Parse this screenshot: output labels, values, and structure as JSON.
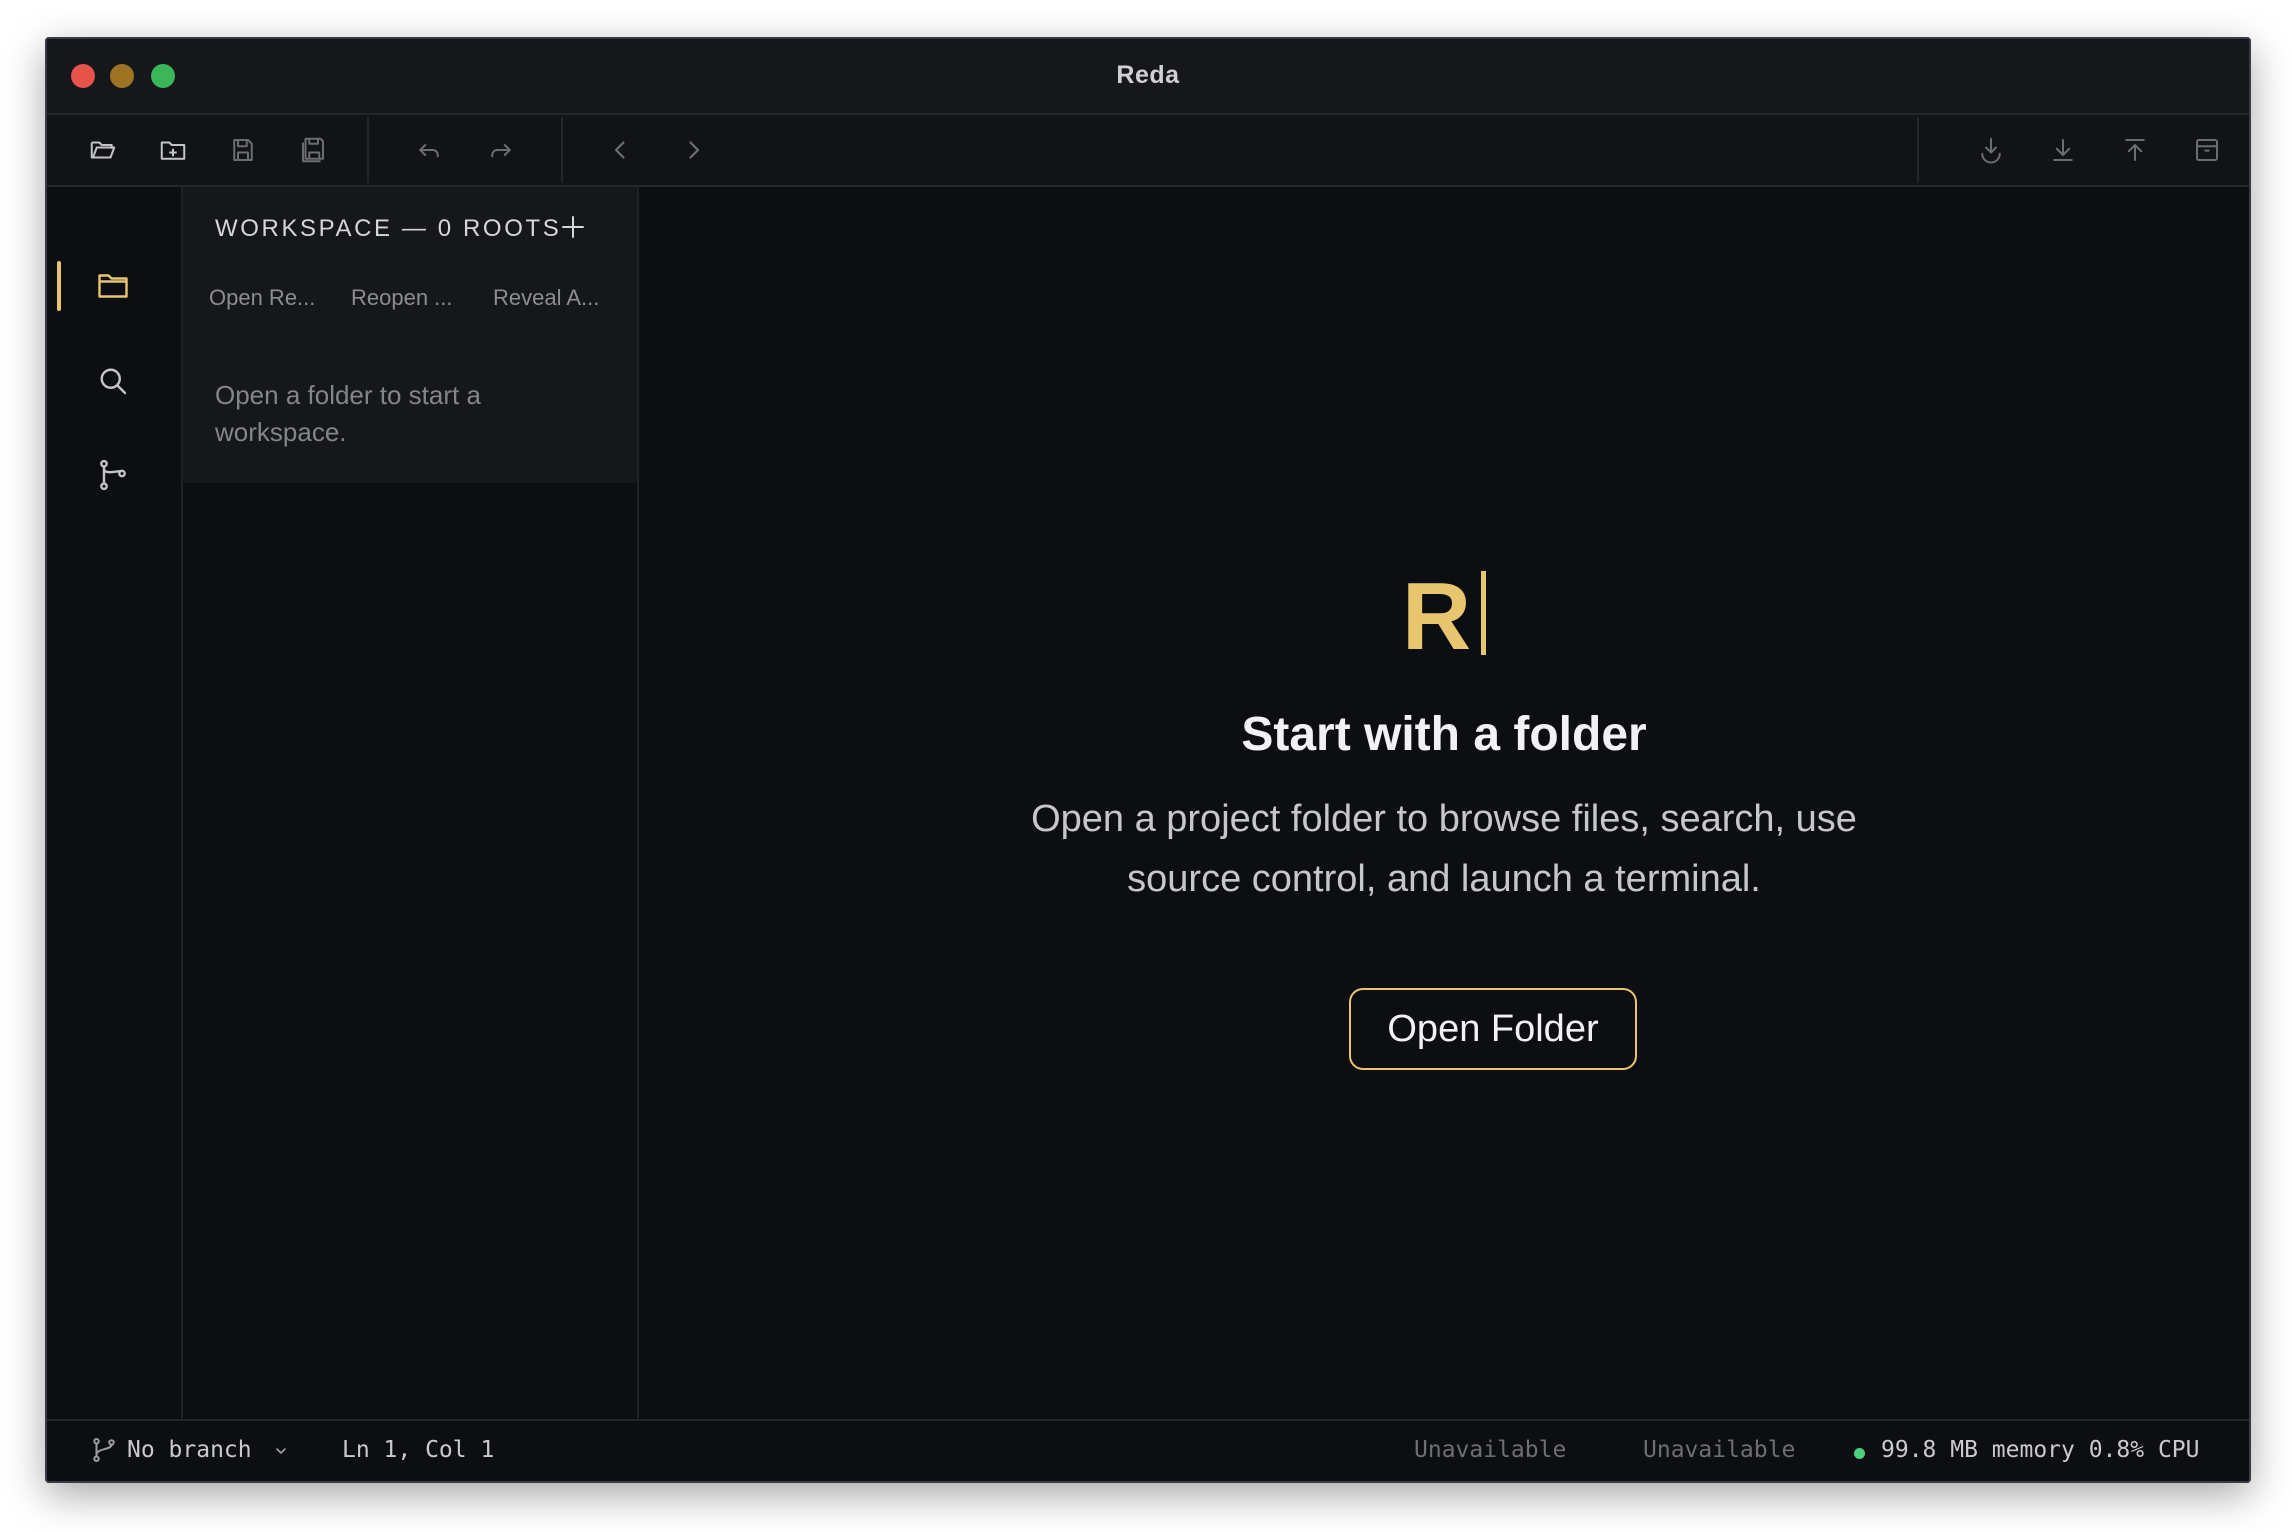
{
  "window": {
    "title": "Reda"
  },
  "toolbar": {
    "icons": [
      "open-folder-icon",
      "new-folder-icon",
      "save-icon",
      "save-all-icon",
      "undo-icon",
      "redo-icon",
      "back-icon",
      "forward-icon",
      "pull-icon",
      "download-icon",
      "push-icon",
      "archive-icon"
    ]
  },
  "activity": {
    "items": [
      "explorer-icon",
      "search-icon",
      "source-control-icon"
    ]
  },
  "sidebar": {
    "header": "WORKSPACE — 0 ROOTS",
    "actions": [
      "Open Re...",
      "Reopen ...",
      "Reveal A..."
    ],
    "empty_message": "Open a folder to start a workspace."
  },
  "welcome": {
    "logo": "R",
    "headline": "Start with a folder",
    "description": "Open a project folder to browse files, search, use source control, and launch a terminal.",
    "button_label": "Open Folder"
  },
  "status": {
    "branch": "No branch",
    "position": "Ln 1, Col 1",
    "indicator_1": "Unavailable",
    "indicator_2": "Unavailable",
    "resources": "99.8 MB memory 0.8% CPU"
  },
  "colors": {
    "accent": "#e7c66f",
    "background": "#0d0e12",
    "status_dot": "#4ad07a"
  }
}
